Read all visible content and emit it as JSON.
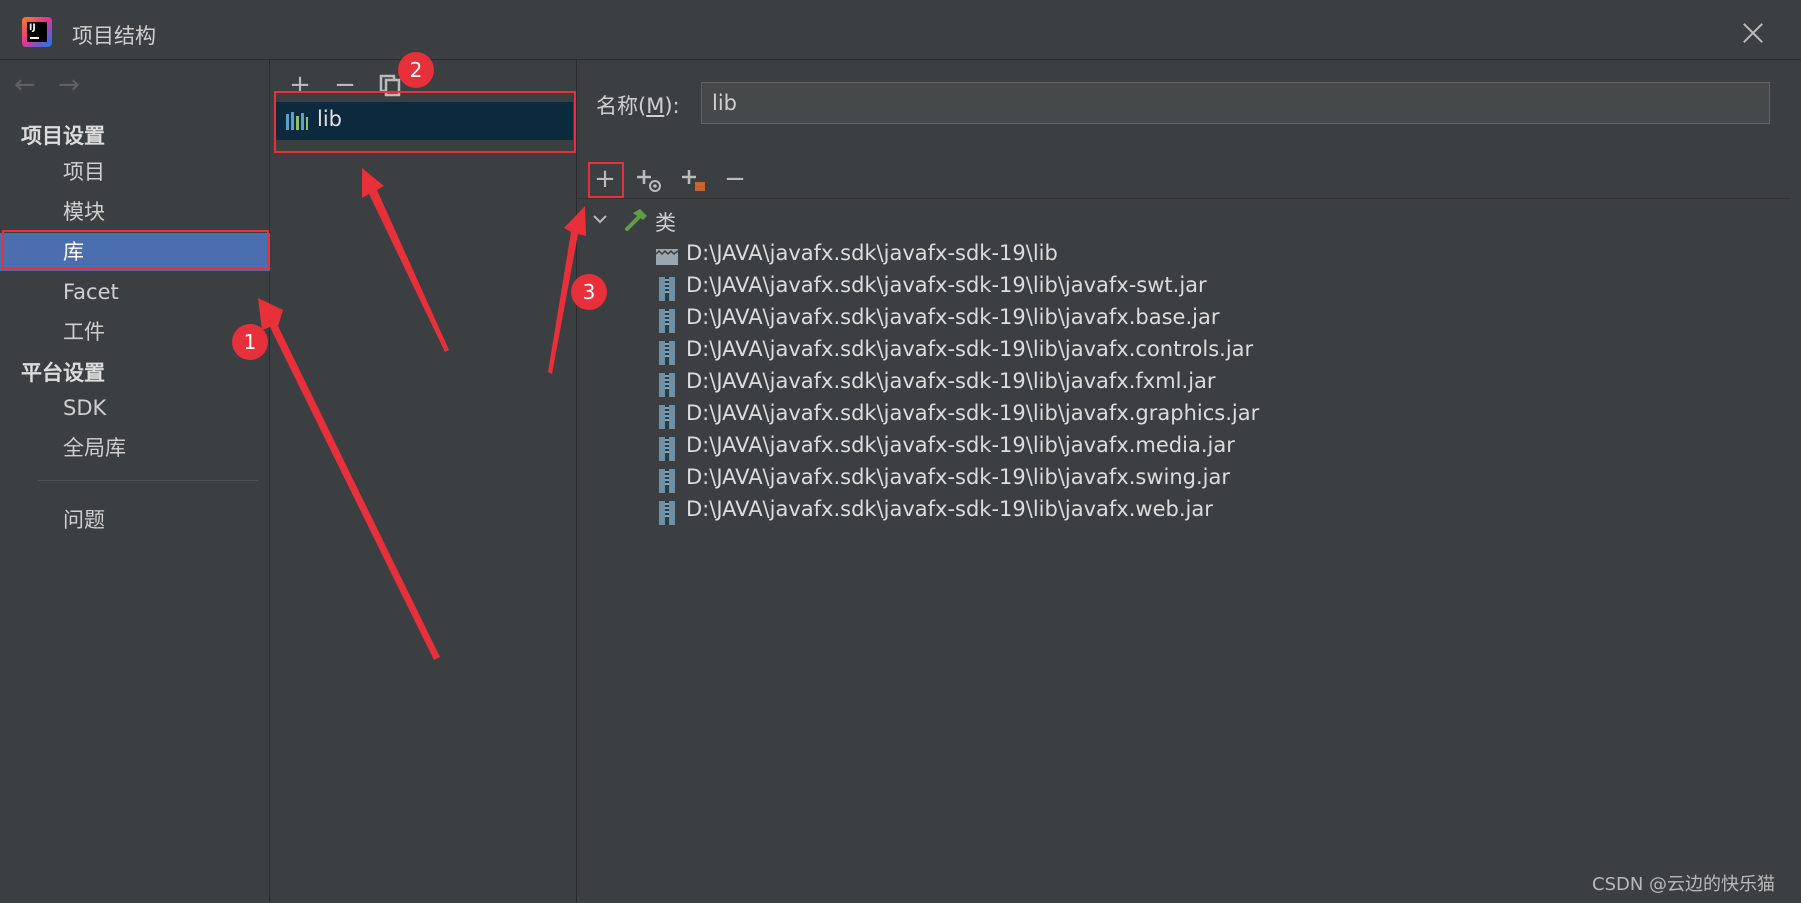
{
  "window": {
    "title": "项目结构",
    "app_icon_text": "IJ"
  },
  "sidebar": {
    "nav_back": "←",
    "nav_forward": "→",
    "project_settings_header": "项目设置",
    "items": [
      {
        "label": "项目"
      },
      {
        "label": "模块"
      },
      {
        "label": "库",
        "selected": true
      },
      {
        "label": "Facet"
      },
      {
        "label": "工件"
      }
    ],
    "platform_settings_header": "平台设置",
    "platform_items": [
      {
        "label": "SDK"
      },
      {
        "label": "全局库"
      }
    ],
    "problems_label": "问题"
  },
  "libraries": {
    "toolbar": {
      "add": "+",
      "remove": "−"
    },
    "items": [
      {
        "label": "lib",
        "selected": true
      }
    ]
  },
  "details": {
    "name_label_prefix": "名称(",
    "name_label_mnemonic": "M",
    "name_label_suffix": "):",
    "name_value": "lib",
    "toolbar": {
      "add": "+",
      "remove": "−"
    },
    "classes_label": "类",
    "paths": [
      "D:\\JAVA\\javafx.sdk\\javafx-sdk-19\\lib",
      "D:\\JAVA\\javafx.sdk\\javafx-sdk-19\\lib\\javafx-swt.jar",
      "D:\\JAVA\\javafx.sdk\\javafx-sdk-19\\lib\\javafx.base.jar",
      "D:\\JAVA\\javafx.sdk\\javafx-sdk-19\\lib\\javafx.controls.jar",
      "D:\\JAVA\\javafx.sdk\\javafx-sdk-19\\lib\\javafx.fxml.jar",
      "D:\\JAVA\\javafx.sdk\\javafx-sdk-19\\lib\\javafx.graphics.jar",
      "D:\\JAVA\\javafx.sdk\\javafx-sdk-19\\lib\\javafx.media.jar",
      "D:\\JAVA\\javafx.sdk\\javafx-sdk-19\\lib\\javafx.swing.jar",
      "D:\\JAVA\\javafx.sdk\\javafx-sdk-19\\lib\\javafx.web.jar"
    ]
  },
  "annotations": {
    "badges": [
      "1",
      "2",
      "3"
    ],
    "color": "#e8303a"
  },
  "watermark": "CSDN @云边的快乐猫",
  "colors": {
    "background": "#3c3f41",
    "selection": "#4b6eaf",
    "lib_selection": "#0d293e",
    "annotation": "#e8303a"
  }
}
